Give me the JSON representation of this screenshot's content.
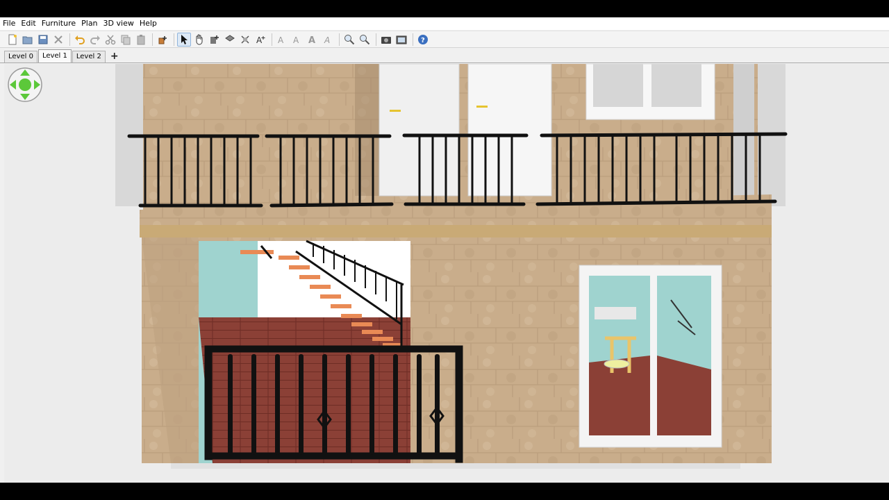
{
  "menubar": {
    "items": [
      "File",
      "Edit",
      "Furniture",
      "Plan",
      "3D view",
      "Help"
    ]
  },
  "toolbar": {
    "buttons": [
      "new-file-icon",
      "open-folder-icon",
      "save-icon",
      "cut-tools-icon",
      "undo-icon",
      "redo-icon",
      "cut-icon",
      "copy-icon",
      "paste-icon",
      "add-furniture-icon",
      "select-arrow-icon",
      "pan-hand-icon",
      "create-walls-icon",
      "create-rooms-icon",
      "create-dimensions-icon",
      "add-text-icon",
      "text-style-icon",
      "increase-text-icon",
      "decrease-text-icon",
      "italic-text-icon",
      "zoom-in-icon",
      "zoom-out-icon",
      "create-photo-icon",
      "create-video-icon",
      "help-icon"
    ],
    "active": "select-arrow-icon"
  },
  "levels": {
    "tabs": [
      "Level 0",
      "Level 1",
      "Level 2"
    ],
    "selected": "Level 1",
    "add_symbol": "+"
  },
  "colors": {
    "stone": "#c8ad8a",
    "stone_dark": "#a88e6e",
    "teal_wall": "#9fd3cf",
    "floor": "#8a3f35",
    "stair": "#e98a55",
    "railing": "#111111",
    "door": "#f4f4f4",
    "window_frame": "#f7f7f7",
    "nav_green": "#5cc83a"
  }
}
